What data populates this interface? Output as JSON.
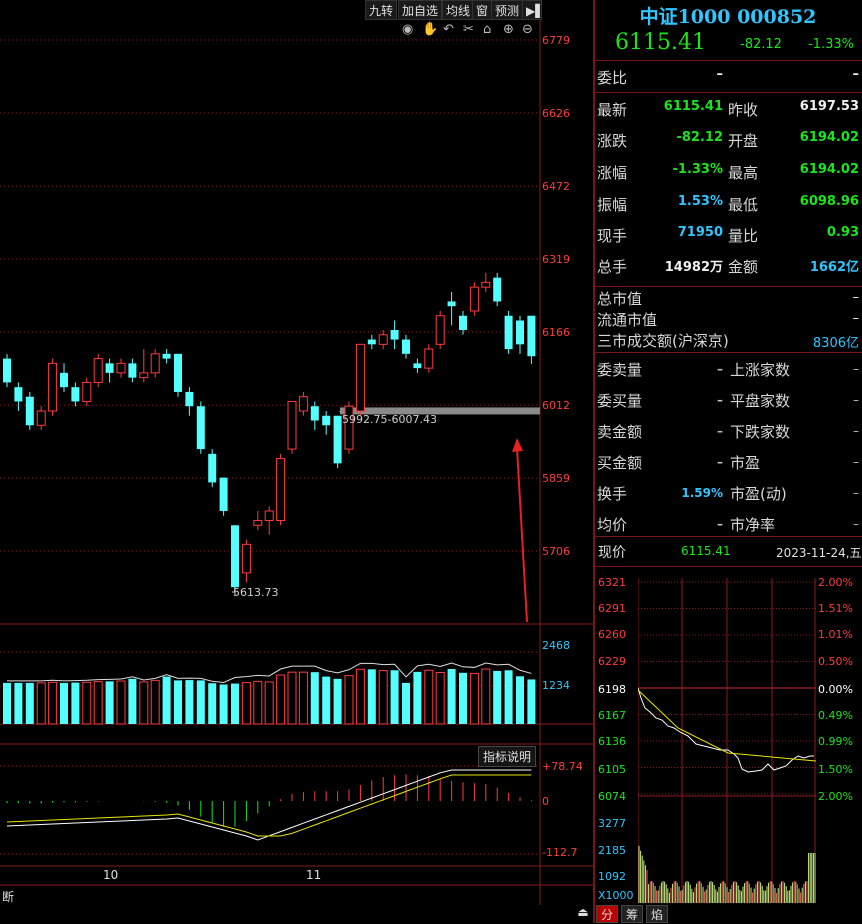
{
  "toolbar": {
    "buttons": [
      "九转",
      "加自选",
      "均线",
      "窗",
      "预测"
    ],
    "tools": [
      "eye-icon",
      "hand-icon",
      "undo-icon",
      "scissors-icon",
      "lock-icon",
      "zoom-in-icon",
      "zoom-out-icon"
    ]
  },
  "price_axis": [
    "6779",
    "6626",
    "6472",
    "6319",
    "6166",
    "6012",
    "5859",
    "5706"
  ],
  "volume_axis": [
    "2468",
    "1234"
  ],
  "macd_axis": [
    "+78.74",
    "0",
    "-112.7"
  ],
  "annotations": {
    "low_label": "5613.73",
    "gap_label": "5992.75-6007.43",
    "indicator_btn": "指标说明"
  },
  "date_axis": [
    "10",
    "11"
  ],
  "bottom_left": "断",
  "header": {
    "name": "中证1000 000852",
    "price": "6115.41",
    "change": "-82.12",
    "change_pct": "-1.33%"
  },
  "weibi": {
    "label": "委比",
    "val1": "–",
    "val2": "–"
  },
  "quote": [
    {
      "l1": "最新",
      "v1": "6115.41",
      "c1": "green",
      "l2": "昨收",
      "v2": "6197.53",
      "c2": "white"
    },
    {
      "l1": "涨跌",
      "v1": "-82.12",
      "c1": "green",
      "l2": "开盘",
      "v2": "6194.02",
      "c2": "green"
    },
    {
      "l1": "涨幅",
      "v1": "-1.33%",
      "c1": "green",
      "l2": "最高",
      "v2": "6194.02",
      "c2": "green"
    },
    {
      "l1": "振幅",
      "v1": "1.53%",
      "c1": "cyan",
      "l2": "最低",
      "v2": "6098.96",
      "c2": "green"
    },
    {
      "l1": "现手",
      "v1": "71950",
      "c1": "cyan",
      "l2": "量比",
      "v2": "0.93",
      "c2": "green"
    },
    {
      "l1": "总手",
      "v1": "14982万",
      "c1": "white",
      "l2": "金额",
      "v2": "1662亿",
      "c2": "cyan"
    }
  ],
  "stats": [
    {
      "label": "总市值",
      "value": "–"
    },
    {
      "label": "流通市值",
      "value": "–"
    },
    {
      "label": "三市成交额(沪深京)",
      "value": "8306亿"
    }
  ],
  "info": [
    {
      "l1": "委卖量",
      "v1": "–",
      "l2": "上涨家数",
      "v2": "–"
    },
    {
      "l1": "委买量",
      "v1": "–",
      "l2": "平盘家数",
      "v2": "–"
    },
    {
      "l1": "卖金额",
      "v1": "–",
      "l2": "下跌家数",
      "v2": "–"
    },
    {
      "l1": "买金额",
      "v1": "–",
      "l2": "市盈",
      "v2": "–"
    },
    {
      "l1": "换手",
      "v1": "1.59%",
      "l2": "市盈(动)",
      "v2": "–"
    },
    {
      "l1": "均价",
      "v1": "–",
      "l2": "市净率",
      "v2": "–"
    }
  ],
  "mini": {
    "label": "现价",
    "price": "6115.41",
    "date": "2023-11-24,五",
    "left_axis": [
      "6321",
      "6291",
      "6260",
      "6229",
      "6198",
      "6167",
      "6136",
      "6105",
      "6074"
    ],
    "right_axis": [
      "2.00%",
      "1.51%",
      "1.01%",
      "0.50%",
      "0.00%",
      "0.49%",
      "0.99%",
      "1.50%",
      "2.00%"
    ],
    "vol_axis": [
      "3277",
      "2185",
      "1092",
      "X1000"
    ]
  },
  "bottom_tabs": [
    "分",
    "筹",
    "焰"
  ],
  "colors": {
    "up": "#ff3b3b",
    "down": "#54ffff",
    "grid": "#8a1a1a",
    "quote_green": "#19e619",
    "accent": "#2fc6ff",
    "title": "#2fc6ff"
  },
  "chart_data": {
    "type": "candlestick",
    "candles": [
      [
        6110,
        6060,
        6120,
        6050
      ],
      [
        6050,
        6020,
        6060,
        6000
      ],
      [
        6030,
        5970,
        6040,
        5960
      ],
      [
        5970,
        6000,
        6010,
        5960
      ],
      [
        6000,
        6100,
        6110,
        5990
      ],
      [
        6080,
        6050,
        6100,
        6040
      ],
      [
        6050,
        6020,
        6060,
        6010
      ],
      [
        6020,
        6060,
        6070,
        6010
      ],
      [
        6060,
        6110,
        6120,
        6050
      ],
      [
        6100,
        6080,
        6110,
        6060
      ],
      [
        6080,
        6100,
        6110,
        6070
      ],
      [
        6100,
        6070,
        6110,
        6060
      ],
      [
        6070,
        6080,
        6130,
        6060
      ],
      [
        6080,
        6120,
        6130,
        6070
      ],
      [
        6120,
        6110,
        6130,
        6100
      ],
      [
        6120,
        6040,
        6120,
        6030
      ],
      [
        6040,
        6010,
        6050,
        5990
      ],
      [
        6010,
        5920,
        6020,
        5910
      ],
      [
        5910,
        5850,
        5920,
        5840
      ],
      [
        5860,
        5790,
        5860,
        5780
      ],
      [
        5760,
        5630,
        5760,
        5614
      ],
      [
        5660,
        5720,
        5730,
        5640
      ],
      [
        5760,
        5770,
        5790,
        5750
      ],
      [
        5770,
        5790,
        5800,
        5740
      ],
      [
        5770,
        5900,
        5910,
        5760
      ],
      [
        5920,
        6020,
        6020,
        5910
      ],
      [
        6000,
        6030,
        6040,
        5990
      ],
      [
        6010,
        5980,
        6020,
        5960
      ],
      [
        5990,
        5970,
        6000,
        5950
      ],
      [
        5990,
        5890,
        5990,
        5880
      ],
      [
        5920,
        6010,
        6020,
        5910
      ],
      [
        6000,
        6140,
        6140,
        5990
      ],
      [
        6150,
        6140,
        6160,
        6130
      ],
      [
        6140,
        6160,
        6170,
        6130
      ],
      [
        6170,
        6150,
        6190,
        6130
      ],
      [
        6150,
        6120,
        6160,
        6110
      ],
      [
        6100,
        6090,
        6110,
        6080
      ],
      [
        6090,
        6130,
        6140,
        6080
      ],
      [
        6140,
        6200,
        6210,
        6130
      ],
      [
        6230,
        6220,
        6250,
        6180
      ],
      [
        6200,
        6170,
        6210,
        6160
      ],
      [
        6210,
        6260,
        6270,
        6200
      ],
      [
        6260,
        6270,
        6290,
        6250
      ],
      [
        6280,
        6230,
        6290,
        6220
      ],
      [
        6200,
        6130,
        6210,
        6120
      ],
      [
        6190,
        6140,
        6200,
        6120
      ],
      [
        6200,
        6115,
        6200,
        6099
      ]
    ],
    "volumes": [
      1300,
      1300,
      1300,
      1300,
      1320,
      1300,
      1310,
      1320,
      1340,
      1350,
      1360,
      1430,
      1330,
      1380,
      1500,
      1380,
      1390,
      1380,
      1290,
      1250,
      1280,
      1310,
      1350,
      1330,
      1550,
      1640,
      1640,
      1640,
      1500,
      1430,
      1530,
      1730,
      1730,
      1690,
      1700,
      1300,
      1650,
      1700,
      1630,
      1740,
      1620,
      1600,
      1740,
      1680,
      1700,
      1510,
      1410
    ],
    "macd_hist": [
      -5,
      -5,
      -6,
      -6,
      -4,
      -3,
      -3,
      -2,
      -1,
      0,
      0,
      0,
      -1,
      -2,
      -4,
      -10,
      -20,
      -35,
      -50,
      -58,
      -58,
      -45,
      -28,
      -12,
      4,
      16,
      20,
      22,
      22,
      22,
      26,
      36,
      46,
      54,
      58,
      60,
      58,
      56,
      50,
      46,
      42,
      40,
      38,
      30,
      18,
      8,
      2
    ],
    "ylim": [
      5600,
      6800
    ]
  }
}
